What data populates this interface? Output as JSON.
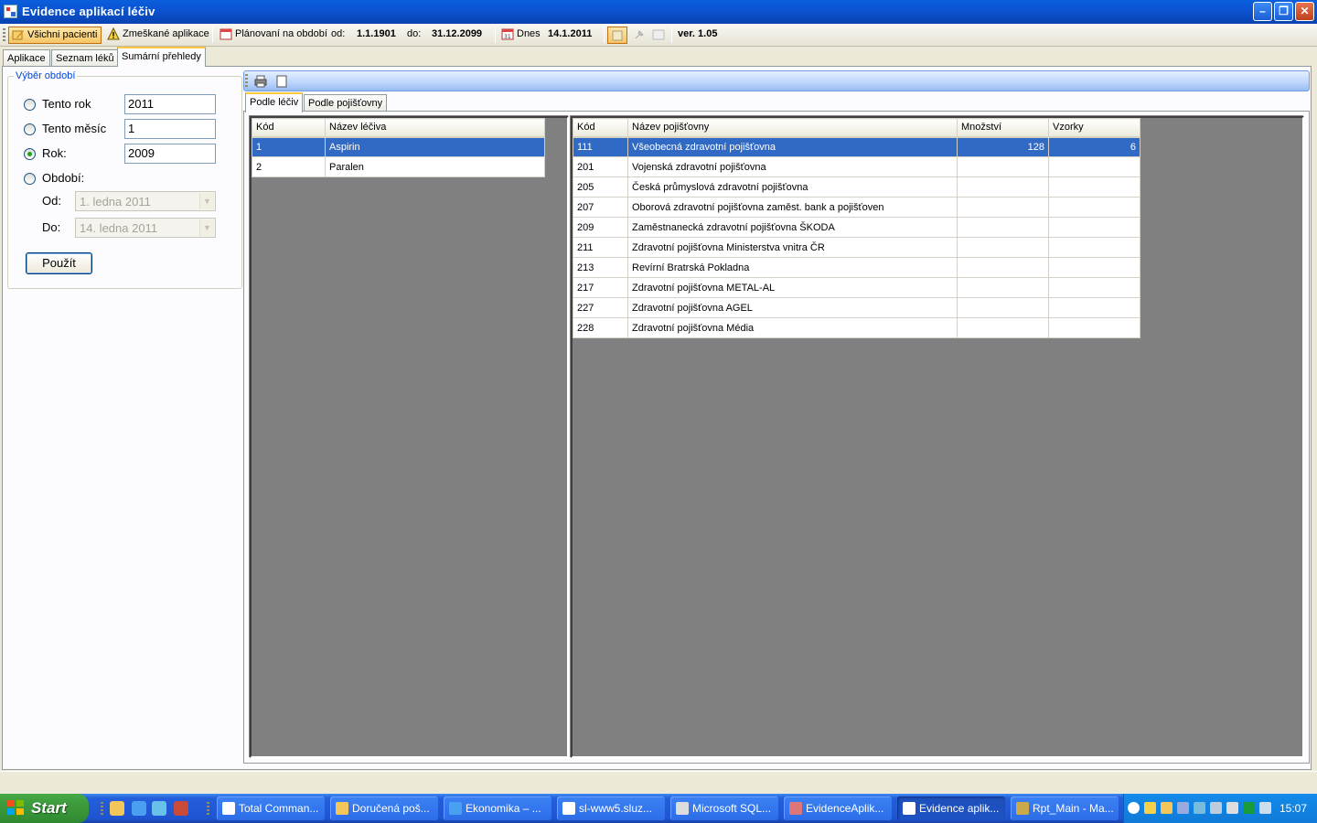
{
  "window": {
    "title": "Evidence aplikací léčiv"
  },
  "toolbar": {
    "all_patients": "Všichni pacienti",
    "missed_apps": "Zmeškané aplikace",
    "planning": "Plánovaní na období",
    "from_label": "od:",
    "from_value": "1.1.1901",
    "to_label": "do:",
    "to_value": "31.12.2099",
    "today_label": "Dnes",
    "today_value": "14.1.2011",
    "version": "ver. 1.05"
  },
  "main_tabs": [
    "Aplikace",
    "Seznam léků",
    "Sumární přehledy"
  ],
  "period": {
    "legend": "Výběr období",
    "this_year_label": "Tento rok",
    "this_year_value": "2011",
    "this_month_label": "Tento měsíc",
    "this_month_value": "1",
    "year_label": "Rok:",
    "year_value": "2009",
    "range_label": "Období:",
    "from_label": "Od:",
    "from_value": "1.   ledna   2011",
    "to_label": "Do:",
    "to_value": "14.  ledna   2011",
    "apply_label": "Použít"
  },
  "sub_tabs": [
    "Podle léčiv",
    "Podle pojišťovny"
  ],
  "drugs_table": {
    "headers": [
      "Kód",
      "Název léčiva"
    ],
    "rows": [
      [
        "1",
        "Aspirin"
      ],
      [
        "2",
        "Paralen"
      ]
    ]
  },
  "insurers_table": {
    "headers": [
      "Kód",
      "Název pojišťovny",
      "Množství",
      "Vzorky"
    ],
    "rows": [
      [
        "111",
        "Všeobecná zdravotní pojišťovna",
        "128",
        "6"
      ],
      [
        "201",
        "Vojenská zdravotní pojišťovna",
        "",
        ""
      ],
      [
        "205",
        "Česká průmyslová zdravotní pojišťovna",
        "",
        ""
      ],
      [
        "207",
        "Oborová zdravotní pojišťovna zaměst. bank a pojišťoven",
        "",
        ""
      ],
      [
        "209",
        "Zaměstnanecká zdravotní pojišťovna ŠKODA",
        "",
        ""
      ],
      [
        "211",
        "Zdravotní pojišťovna Ministerstva vnitra ČR",
        "",
        ""
      ],
      [
        "213",
        "Revírní Bratrská Pokladna",
        "",
        ""
      ],
      [
        "217",
        "Zdravotní pojišťovna METAL-AL",
        "",
        ""
      ],
      [
        "227",
        "Zdravotní pojišťovna AGEL",
        "",
        ""
      ],
      [
        "228",
        "Zdravotní pojišťovna Média",
        "",
        ""
      ]
    ]
  },
  "taskbar": {
    "start": "Start",
    "tasks": [
      "Total Comman...",
      "Doručená poš...",
      "Ekonomika – ...",
      "sl-www5.sluz...",
      "Microsoft SQL...",
      "EvidenceAplik...",
      "Evidence aplik...",
      "Rpt_Main - Ma..."
    ],
    "clock": "15:07"
  },
  "colors": {
    "selection": "#316ac5",
    "titlebar": "#0A5FDC",
    "grid_background": "#808080"
  }
}
